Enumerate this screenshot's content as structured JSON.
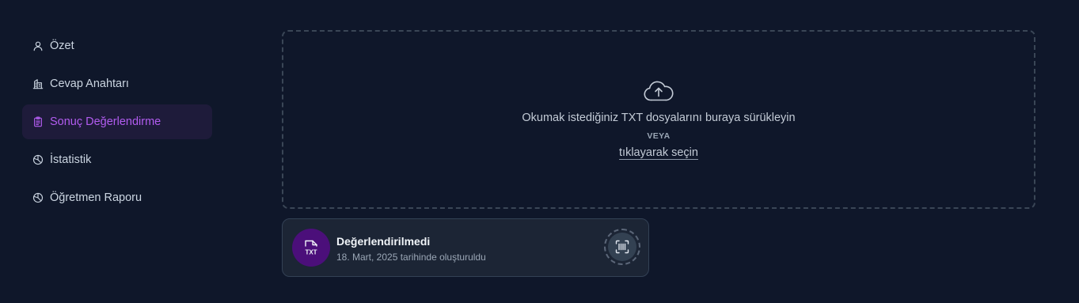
{
  "sidebar": {
    "items": [
      {
        "label": "Özet",
        "icon": "user-icon",
        "active": false
      },
      {
        "label": "Cevap Anahtarı",
        "icon": "building-icon",
        "active": false
      },
      {
        "label": "Sonuç Değerlendirme",
        "icon": "clipboard-icon",
        "active": true
      },
      {
        "label": "İstatistik",
        "icon": "pie-chart-icon",
        "active": false
      },
      {
        "label": "Öğretmen Raporu",
        "icon": "pie-chart-icon",
        "active": false
      }
    ]
  },
  "upload": {
    "icon": "cloud-upload-icon",
    "instruction": "Okumak istediğiniz TXT dosyalarını buraya sürükleyin",
    "or": "VEYA",
    "select_link": "tıklayarak seçin"
  },
  "file": {
    "type_label": "TXT",
    "title": "Değerlendirilmedi",
    "date": "18. Mart, 2025 tarihinde oluşturuldu",
    "action_icon": "barcode-scan-icon"
  },
  "colors": {
    "background": "#0f172a",
    "accent": "#b25cf0",
    "active_bg": "#1e1b3a",
    "file_badge": "#4b0f7a"
  }
}
